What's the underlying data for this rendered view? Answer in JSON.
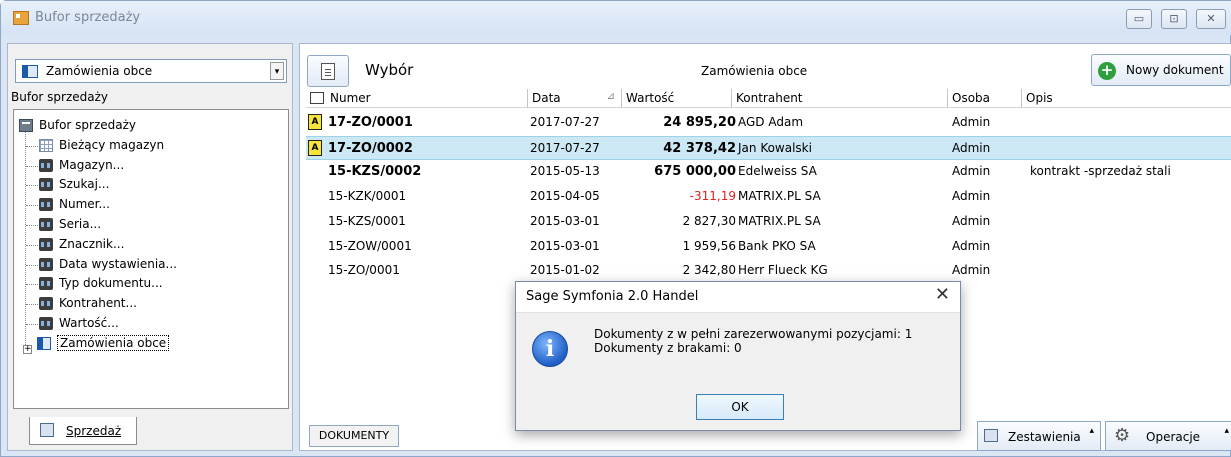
{
  "window": {
    "title": "Bufor sprzedaży",
    "min_glyph": "▭",
    "max_glyph": "⊡",
    "close_glyph": "✕"
  },
  "left": {
    "combo_value": "Zamówienia obce",
    "combo_arrow": "▾",
    "label": "Bufor sprzedaży",
    "tree": [
      {
        "label": "Bufor sprzedaży",
        "icon": "buffer-bin-icon"
      },
      {
        "label": "Bieżący magazyn",
        "icon": "grid-icon"
      },
      {
        "label": "Magazyn...",
        "icon": "binoculars-icon"
      },
      {
        "label": "Szukaj...",
        "icon": "binoculars-icon"
      },
      {
        "label": "Numer...",
        "icon": "binoculars-icon"
      },
      {
        "label": "Seria...",
        "icon": "binoculars-icon"
      },
      {
        "label": "Znacznik...",
        "icon": "binoculars-icon"
      },
      {
        "label": "Data wystawienia...",
        "icon": "binoculars-icon"
      },
      {
        "label": "Typ dokumentu...",
        "icon": "binoculars-icon"
      },
      {
        "label": "Kontrahent...",
        "icon": "binoculars-icon"
      },
      {
        "label": "Wartość...",
        "icon": "binoculars-icon"
      },
      {
        "label": "Zamówienia obce",
        "icon": "document-folder-icon"
      }
    ],
    "expander": "+",
    "tab": "Sprzedaż"
  },
  "toolbar": {
    "wybor_label": "Wybór",
    "list_title": "Zamówienia obce",
    "new_doc_label": "Nowy dokument",
    "new_doc_glyph": "+"
  },
  "table": {
    "headers": {
      "numer": "Numer",
      "data": "Data",
      "sort_glyph": "⊿",
      "wartosc": "Wartość",
      "kontrahent": "Kontrahent",
      "osoba": "Osoba",
      "opis": "Opis"
    },
    "rows": [
      {
        "lock": "A",
        "numer": "17-ZO/0001",
        "data": "2017-07-27",
        "wartosc": "24 895,20",
        "kontrahent": "AGD Adam",
        "osoba": "Admin",
        "opis": ""
      },
      {
        "lock": "A",
        "numer": "17-ZO/0002",
        "data": "2017-07-27",
        "wartosc": "42 378,42",
        "kontrahent": "Jan Kowalski",
        "osoba": "Admin",
        "opis": ""
      },
      {
        "lock": "",
        "numer": "15-KZS/0002",
        "data": "2015-05-13",
        "wartosc": "675 000,00",
        "kontrahent": "Edelweiss SA",
        "osoba": "Admin",
        "opis": "kontrakt -sprzedaż stali"
      },
      {
        "lock": "",
        "numer": "15-KZK/0001",
        "data": "2015-04-05",
        "wartosc": "-311,19",
        "kontrahent": "MATRIX.PL SA",
        "osoba": "Admin",
        "opis": ""
      },
      {
        "lock": "",
        "numer": "15-KZS/0001",
        "data": "2015-03-01",
        "wartosc": "2 827,30",
        "kontrahent": "MATRIX.PL SA",
        "osoba": "Admin",
        "opis": ""
      },
      {
        "lock": "",
        "numer": "15-ZOW/0001",
        "data": "2015-03-01",
        "wartosc": "1 959,56",
        "kontrahent": "Bank PKO SA",
        "osoba": "Admin",
        "opis": ""
      },
      {
        "lock": "",
        "numer": "15-ZO/0001",
        "data": "2015-01-02",
        "wartosc": "2 342,80",
        "kontrahent": "Herr Flueck KG",
        "osoba": "Admin",
        "opis": ""
      }
    ]
  },
  "bottom": {
    "dokumenty": "DOKUMENTY",
    "zestawienia": "Zestawienia",
    "operacje": "Operacje",
    "up_glyph": "▴"
  },
  "dialog": {
    "title": "Sage Symfonia 2.0 Handel",
    "close_glyph": "✕",
    "icon_glyph": "i",
    "line1": "Dokumenty z w pełni zarezerwowanymi pozycjami: 1",
    "line2": "Dokumenty z brakami: 0",
    "ok": "OK"
  }
}
